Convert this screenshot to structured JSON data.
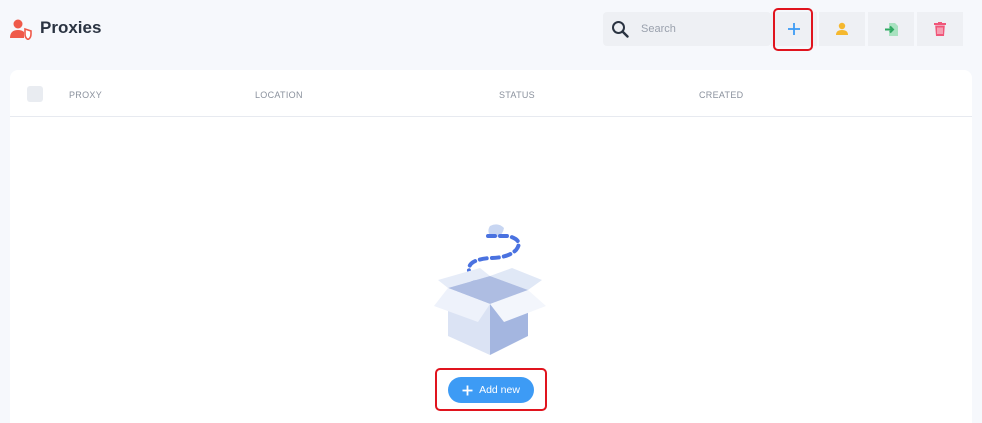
{
  "header": {
    "title": "Proxies",
    "page_icon": "user-shield-icon"
  },
  "toolbar": {
    "search": {
      "placeholder": "Search",
      "value": ""
    },
    "buttons": [
      {
        "name": "add-proxy-button",
        "icon": "plus-icon",
        "color": "#3d9bf5",
        "highlighted": true
      },
      {
        "name": "user-button",
        "icon": "user-icon",
        "color": "#f5b82e"
      },
      {
        "name": "import-button",
        "icon": "file-import-icon",
        "color": "#4cc07a"
      },
      {
        "name": "delete-button",
        "icon": "trash-icon",
        "color": "#f0577a"
      }
    ]
  },
  "table": {
    "columns": [
      "PROXY",
      "LOCATION",
      "STATUS",
      "CREATED"
    ],
    "rows": []
  },
  "empty_state": {
    "illustration": "open-box-icon",
    "add_new_label": "Add new",
    "highlighted": true
  },
  "colors": {
    "accent": "#3d9bf5",
    "highlight": "#e0141e",
    "background": "#f6f8fc"
  }
}
